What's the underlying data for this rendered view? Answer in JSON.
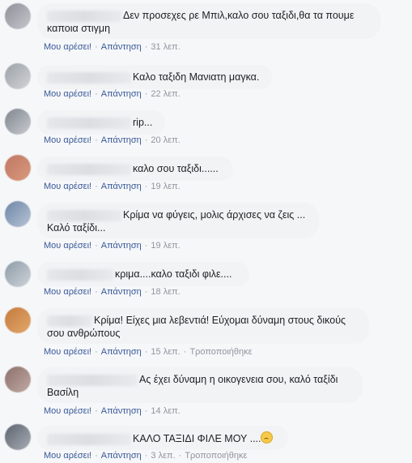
{
  "actions": {
    "like": "Μου αρέσει!",
    "reply": "Απάντηση",
    "edited": "Τροποποιήθηκε",
    "sep": "·"
  },
  "comments": [
    {
      "text_line1": "Δεν προσεχες ρε Μπιλ,καλο σου ταξιδι,θα τα πουμε",
      "text_line2": "καποια στιγμη",
      "time": "31 λεπ."
    },
    {
      "text_line1": "Καλο ταξιδη Μανιατη μαγκα.",
      "time": "22 λεπ."
    },
    {
      "text_line1": "rip...",
      "time": "20 λεπ."
    },
    {
      "text_line1": "καλο σου ταξιδι......",
      "time": "19 λεπ."
    },
    {
      "text_line1": "Κρίμα να φύγεις, μολις άρχισες να ζεις ...",
      "text_line2": "Καλό ταξίδι...",
      "time": "19 λεπ."
    },
    {
      "text_line1": "κριμα....καλο ταξιδι φιλε....",
      "time": "18 λεπ."
    },
    {
      "text_line1": "Κρίμα! Είχες μια λεβεντιά! Εύχομαι δύναμη στους δικούς",
      "text_line2": "σου ανθρώπους",
      "time": "15 λεπ."
    },
    {
      "text_line1": "Ας έχει δύναμη η οικογενεια σου, καλό ταξίδι",
      "text_line2": "Βασίλη",
      "time": "14 λεπ."
    },
    {
      "text_line1": "ΚΑΛΟ ΤΑΞΙΔΙ ΦΙΛΕ ΜΟΥ ....",
      "time": "3 λεπ."
    }
  ]
}
